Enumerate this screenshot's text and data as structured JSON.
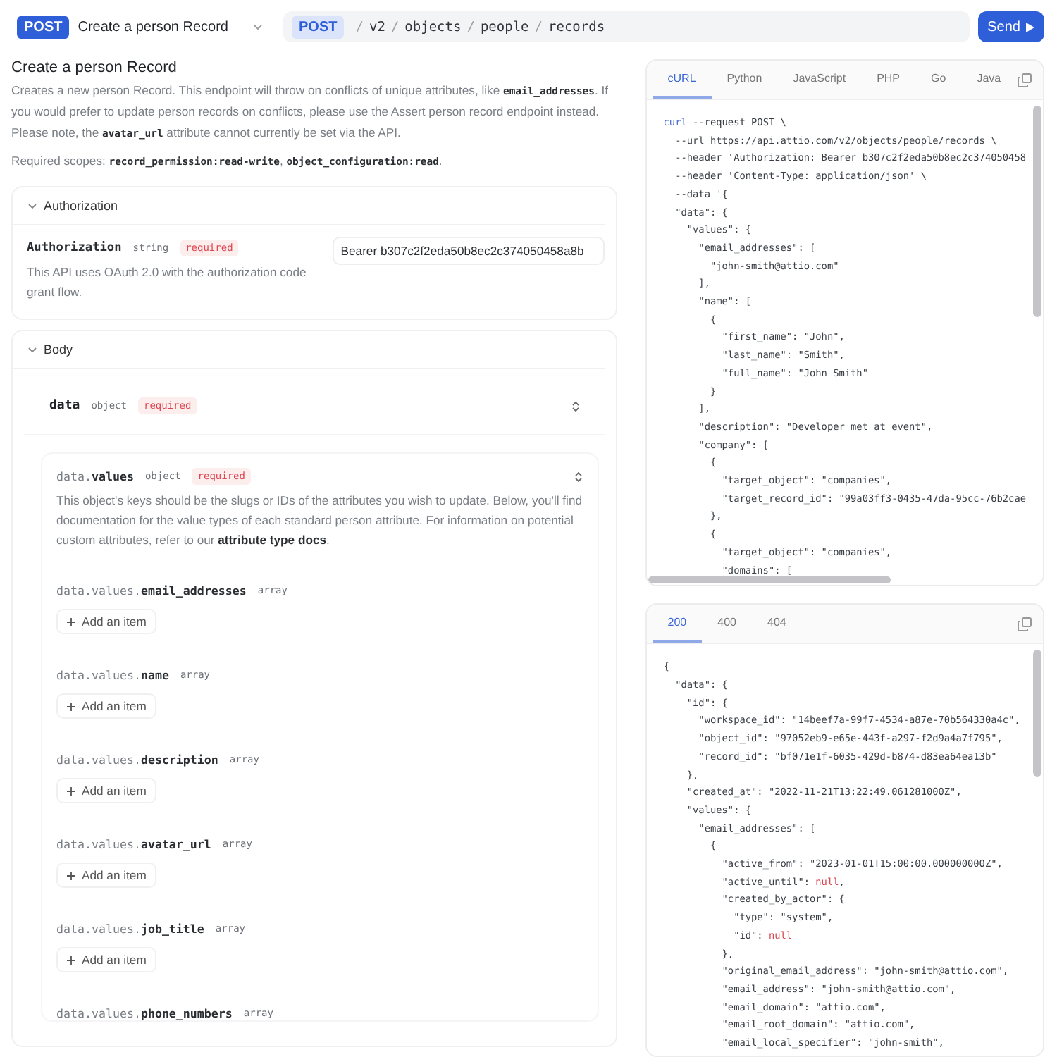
{
  "top_bar": {
    "method": "POST",
    "endpoint_title": "Create a person Record",
    "url_method": "POST",
    "separator": "/",
    "url_segments": [
      "v2",
      "objects",
      "people",
      "records"
    ],
    "send_label": "Send"
  },
  "intro": {
    "title": "Create a person Record",
    "description": "Creates a new person Record. This endpoint will throw on conflicts of unique attributes, like **email_addresses**. If you would prefer to update person records on conflicts, please use the Assert person record endpoint instead. Please note, the **avatar_url** attribute cannot currently be set via the API.",
    "scopes": "Required scopes: **record_permission:read-write**, **object_configuration:read**."
  },
  "authorization": {
    "heading": "Authorization",
    "expanded": true,
    "param_name": "Authorization",
    "param_type": "string",
    "badge": "required",
    "description": "This API uses OAuth 2.0 with the authorization code grant flow.",
    "value": "Bearer b307c2f2eda50b8ec2c374050458a8b"
  },
  "body": {
    "heading": "Body",
    "expanded": true,
    "data": {
      "name": "data",
      "type": "object",
      "badge": "required"
    },
    "values": {
      "name": "data.**values**",
      "type": "object",
      "badge": "required",
      "description": "This object's keys should be the slugs or IDs of the attributes you wish to update. Below, you'll find documentation for the value types of each standard person attribute. For information on potential custom attributes, refer to our **attribute type docs**.",
      "fields": [
        {
          "name": "data.values.**email_addresses**",
          "type": "array",
          "button": "Add an item"
        },
        {
          "name": "data.values.**name**",
          "type": "array",
          "button": "Add an item"
        },
        {
          "name": "data.values.**description**",
          "type": "array",
          "button": "Add an item"
        },
        {
          "name": "data.values.**avatar_url**",
          "type": "array",
          "button": "Add an item"
        },
        {
          "name": "data.values.**job_title**",
          "type": "array",
          "button": "Add an item"
        },
        {
          "name": "data.values.**phone_numbers**",
          "type": "array"
        }
      ]
    }
  },
  "request_panel": {
    "tabs": [
      {
        "label": "cURL",
        "selected": true
      },
      {
        "label": "Python",
        "selected": false
      },
      {
        "label": "JavaScript",
        "selected": false
      },
      {
        "label": "PHP",
        "selected": false
      },
      {
        "label": "Go",
        "selected": false
      },
      {
        "label": "Java",
        "selected": false
      }
    ],
    "lines": [
      [
        {
          "text": "curl",
          "kind": "keyword"
        },
        {
          "text": " --request POST \\",
          "kind": "plain"
        }
      ],
      "  --url https://api.attio.com/v2/objects/people/records \\",
      "  --header 'Authorization: Bearer b307c2f2eda50b8ec2c374050458",
      "  --header 'Content-Type: application/json' \\",
      "  --data '{",
      "  \"data\": {",
      "    \"values\": {",
      "      \"email_addresses\": [",
      "        \"john-smith@attio.com\"",
      "      ],",
      "      \"name\": [",
      "        {",
      "          \"first_name\": \"John\",",
      "          \"last_name\": \"Smith\",",
      "          \"full_name\": \"John Smith\"",
      "        }",
      "      ],",
      "      \"description\": \"Developer met at event\",",
      "      \"company\": [",
      "        {",
      "          \"target_object\": \"companies\",",
      "          \"target_record_id\": \"99a03ff3-0435-47da-95cc-76b2cae",
      "        },",
      "        {",
      "          \"target_object\": \"companies\",",
      "          \"domains\": ["
    ]
  },
  "response_panel": {
    "tabs": [
      {
        "label": "200",
        "selected": true
      },
      {
        "label": "400",
        "selected": false
      },
      {
        "label": "404",
        "selected": false
      }
    ],
    "lines": [
      "{",
      "  \"data\": {",
      "    \"id\": {",
      "      \"workspace_id\": \"14beef7a-99f7-4534-a87e-70b564330a4c\",",
      "      \"object_id\": \"97052eb9-e65e-443f-a297-f2d9a4a7f795\",",
      "      \"record_id\": \"bf071e1f-6035-429d-b874-d83ea64ea13b\"",
      "    },",
      "    \"created_at\": \"2022-11-21T13:22:49.061281000Z\",",
      "    \"values\": {",
      "      \"email_addresses\": [",
      "        {",
      "          \"active_from\": \"2023-01-01T15:00:00.000000000Z\",",
      [
        {
          "text": "          \"active_until\": ",
          "kind": "plain"
        },
        {
          "text": "null",
          "kind": "null"
        },
        {
          "text": ",",
          "kind": "plain"
        }
      ],
      "          \"created_by_actor\": {",
      "            \"type\": \"system\",",
      [
        {
          "text": "            \"id\": ",
          "kind": "plain"
        },
        {
          "text": "null",
          "kind": "null"
        }
      ],
      "          },",
      "          \"original_email_address\": \"john-smith@attio.com\",",
      "          \"email_address\": \"john-smith@attio.com\",",
      "          \"email_domain\": \"attio.com\",",
      "          \"email_root_domain\": \"attio.com\",",
      "          \"email_local_specifier\": \"john-smith\","
    ]
  }
}
